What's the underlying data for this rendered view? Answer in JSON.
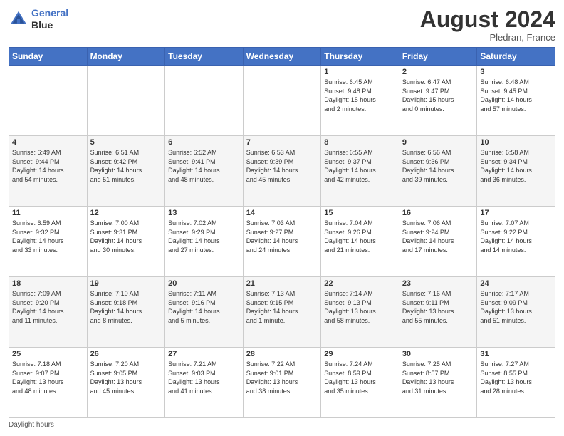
{
  "header": {
    "logo_line1": "General",
    "logo_line2": "Blue",
    "month_year": "August 2024",
    "location": "Pledran, France"
  },
  "footer": {
    "label": "Daylight hours"
  },
  "days_of_week": [
    "Sunday",
    "Monday",
    "Tuesday",
    "Wednesday",
    "Thursday",
    "Friday",
    "Saturday"
  ],
  "weeks": [
    [
      {
        "day": "",
        "info": ""
      },
      {
        "day": "",
        "info": ""
      },
      {
        "day": "",
        "info": ""
      },
      {
        "day": "",
        "info": ""
      },
      {
        "day": "1",
        "info": "Sunrise: 6:45 AM\nSunset: 9:48 PM\nDaylight: 15 hours\nand 2 minutes."
      },
      {
        "day": "2",
        "info": "Sunrise: 6:47 AM\nSunset: 9:47 PM\nDaylight: 15 hours\nand 0 minutes."
      },
      {
        "day": "3",
        "info": "Sunrise: 6:48 AM\nSunset: 9:45 PM\nDaylight: 14 hours\nand 57 minutes."
      }
    ],
    [
      {
        "day": "4",
        "info": "Sunrise: 6:49 AM\nSunset: 9:44 PM\nDaylight: 14 hours\nand 54 minutes."
      },
      {
        "day": "5",
        "info": "Sunrise: 6:51 AM\nSunset: 9:42 PM\nDaylight: 14 hours\nand 51 minutes."
      },
      {
        "day": "6",
        "info": "Sunrise: 6:52 AM\nSunset: 9:41 PM\nDaylight: 14 hours\nand 48 minutes."
      },
      {
        "day": "7",
        "info": "Sunrise: 6:53 AM\nSunset: 9:39 PM\nDaylight: 14 hours\nand 45 minutes."
      },
      {
        "day": "8",
        "info": "Sunrise: 6:55 AM\nSunset: 9:37 PM\nDaylight: 14 hours\nand 42 minutes."
      },
      {
        "day": "9",
        "info": "Sunrise: 6:56 AM\nSunset: 9:36 PM\nDaylight: 14 hours\nand 39 minutes."
      },
      {
        "day": "10",
        "info": "Sunrise: 6:58 AM\nSunset: 9:34 PM\nDaylight: 14 hours\nand 36 minutes."
      }
    ],
    [
      {
        "day": "11",
        "info": "Sunrise: 6:59 AM\nSunset: 9:32 PM\nDaylight: 14 hours\nand 33 minutes."
      },
      {
        "day": "12",
        "info": "Sunrise: 7:00 AM\nSunset: 9:31 PM\nDaylight: 14 hours\nand 30 minutes."
      },
      {
        "day": "13",
        "info": "Sunrise: 7:02 AM\nSunset: 9:29 PM\nDaylight: 14 hours\nand 27 minutes."
      },
      {
        "day": "14",
        "info": "Sunrise: 7:03 AM\nSunset: 9:27 PM\nDaylight: 14 hours\nand 24 minutes."
      },
      {
        "day": "15",
        "info": "Sunrise: 7:04 AM\nSunset: 9:26 PM\nDaylight: 14 hours\nand 21 minutes."
      },
      {
        "day": "16",
        "info": "Sunrise: 7:06 AM\nSunset: 9:24 PM\nDaylight: 14 hours\nand 17 minutes."
      },
      {
        "day": "17",
        "info": "Sunrise: 7:07 AM\nSunset: 9:22 PM\nDaylight: 14 hours\nand 14 minutes."
      }
    ],
    [
      {
        "day": "18",
        "info": "Sunrise: 7:09 AM\nSunset: 9:20 PM\nDaylight: 14 hours\nand 11 minutes."
      },
      {
        "day": "19",
        "info": "Sunrise: 7:10 AM\nSunset: 9:18 PM\nDaylight: 14 hours\nand 8 minutes."
      },
      {
        "day": "20",
        "info": "Sunrise: 7:11 AM\nSunset: 9:16 PM\nDaylight: 14 hours\nand 5 minutes."
      },
      {
        "day": "21",
        "info": "Sunrise: 7:13 AM\nSunset: 9:15 PM\nDaylight: 14 hours\nand 1 minute."
      },
      {
        "day": "22",
        "info": "Sunrise: 7:14 AM\nSunset: 9:13 PM\nDaylight: 13 hours\nand 58 minutes."
      },
      {
        "day": "23",
        "info": "Sunrise: 7:16 AM\nSunset: 9:11 PM\nDaylight: 13 hours\nand 55 minutes."
      },
      {
        "day": "24",
        "info": "Sunrise: 7:17 AM\nSunset: 9:09 PM\nDaylight: 13 hours\nand 51 minutes."
      }
    ],
    [
      {
        "day": "25",
        "info": "Sunrise: 7:18 AM\nSunset: 9:07 PM\nDaylight: 13 hours\nand 48 minutes."
      },
      {
        "day": "26",
        "info": "Sunrise: 7:20 AM\nSunset: 9:05 PM\nDaylight: 13 hours\nand 45 minutes."
      },
      {
        "day": "27",
        "info": "Sunrise: 7:21 AM\nSunset: 9:03 PM\nDaylight: 13 hours\nand 41 minutes."
      },
      {
        "day": "28",
        "info": "Sunrise: 7:22 AM\nSunset: 9:01 PM\nDaylight: 13 hours\nand 38 minutes."
      },
      {
        "day": "29",
        "info": "Sunrise: 7:24 AM\nSunset: 8:59 PM\nDaylight: 13 hours\nand 35 minutes."
      },
      {
        "day": "30",
        "info": "Sunrise: 7:25 AM\nSunset: 8:57 PM\nDaylight: 13 hours\nand 31 minutes."
      },
      {
        "day": "31",
        "info": "Sunrise: 7:27 AM\nSunset: 8:55 PM\nDaylight: 13 hours\nand 28 minutes."
      }
    ]
  ]
}
